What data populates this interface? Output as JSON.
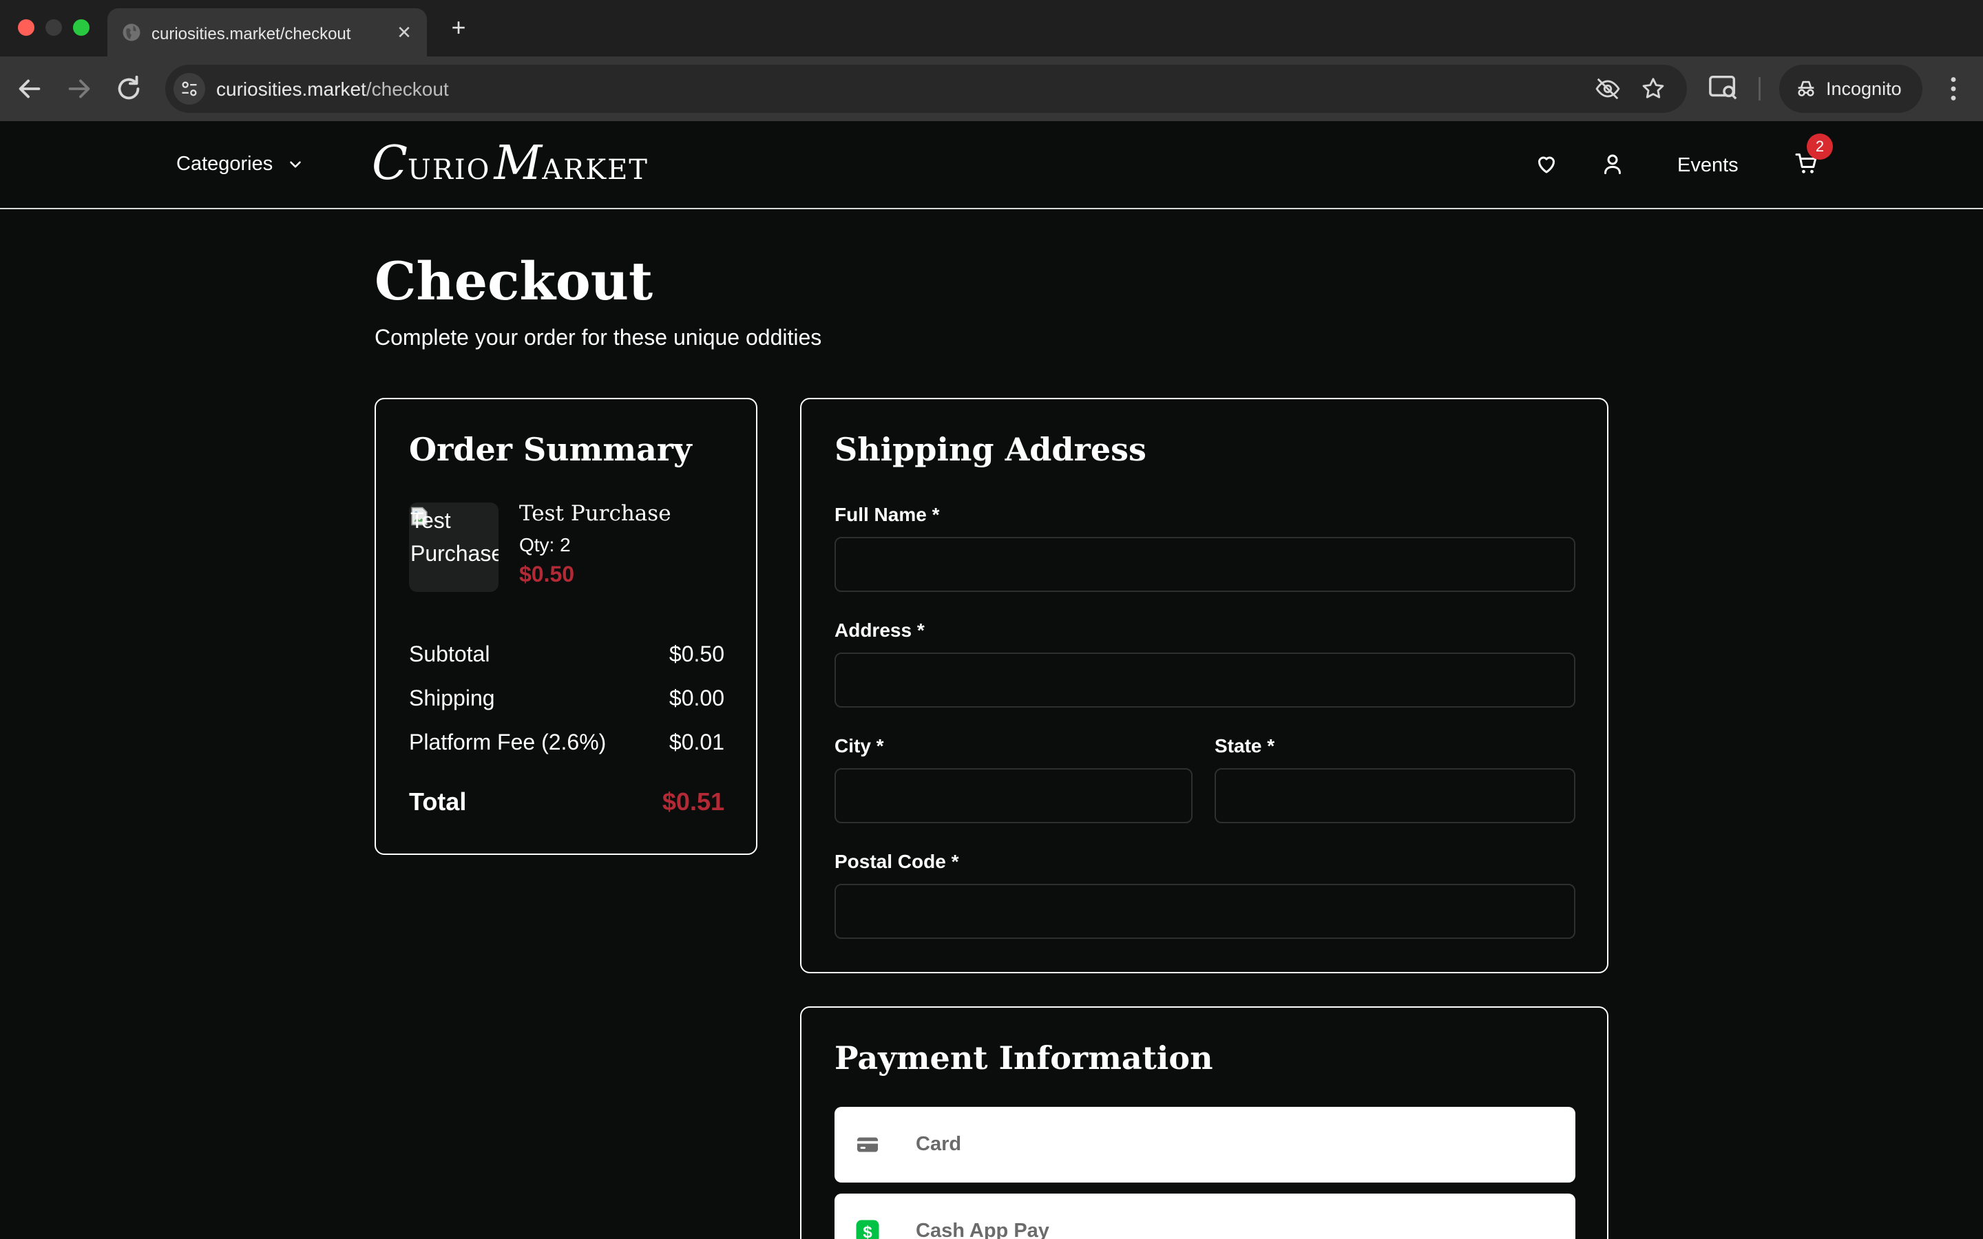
{
  "browser": {
    "tab_title": "curiosities.market/checkout",
    "url_domain": "curiosities.market",
    "url_path": "/checkout",
    "incognito_label": "Incognito",
    "new_tab_symbol": "+",
    "close_symbol": "✕"
  },
  "header": {
    "categories_label": "Categories",
    "logo": {
      "c": "C",
      "urio": "URIO",
      "m": "M",
      "arket": "ARKET"
    },
    "events_label": "Events",
    "cart_count": "2"
  },
  "page": {
    "title": "Checkout",
    "subtitle": "Complete your order for these unique oddities"
  },
  "order_summary": {
    "title": "Order Summary",
    "item": {
      "image_alt": "Test Purchase",
      "name": "Test Purchase",
      "qty": "Qty: 2",
      "price": "$0.50"
    },
    "rows": [
      {
        "label": "Subtotal",
        "value": "$0.50"
      },
      {
        "label": "Shipping",
        "value": "$0.00"
      },
      {
        "label": "Platform Fee (2.6%)",
        "value": "$0.01"
      }
    ],
    "total": {
      "label": "Total",
      "value": "$0.51"
    }
  },
  "shipping": {
    "title": "Shipping Address",
    "full_name_label": "Full Name *",
    "address_label": "Address *",
    "city_label": "City *",
    "state_label": "State *",
    "postal_label": "Postal Code *",
    "full_name_value": "",
    "address_value": "",
    "city_value": "",
    "state_value": "",
    "postal_value": ""
  },
  "payment": {
    "title": "Payment Information",
    "options": [
      {
        "label": "Card",
        "icon": "card-icon"
      },
      {
        "label": "Cash App Pay",
        "icon": "cash-app-icon"
      }
    ]
  },
  "colors": {
    "accent_price": "#b32a36",
    "badge": "#d82a2f",
    "background": "#0b0d0c",
    "cash_app_green": "#00c244"
  }
}
